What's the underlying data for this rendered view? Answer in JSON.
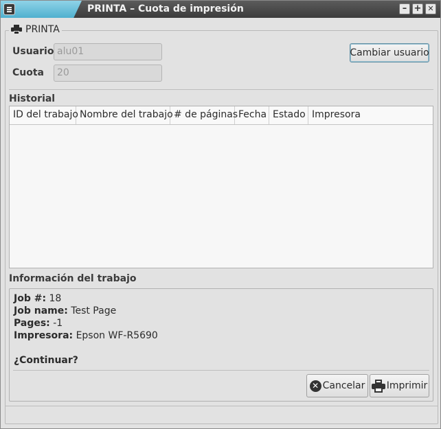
{
  "window": {
    "title": "PRINTA – Cuota de impresión",
    "minimize_icon": "minus-icon",
    "maximize_icon": "plus-icon",
    "close_icon": "x-icon",
    "minimize_glyph": "–",
    "maximize_glyph": "+",
    "close_glyph": "✕",
    "accent_color": "#5fb8d4"
  },
  "group": {
    "title": "PRINTA",
    "icon": "printer-icon"
  },
  "user": {
    "usuario_label": "Usuario",
    "usuario_value": "alu01",
    "cuota_label": "Cuota",
    "cuota_value": "20",
    "change_user_button": "Cambiar usuario"
  },
  "history": {
    "title": "Historial",
    "columns": [
      "ID del trabajo",
      "Nombre del trabajo",
      "# de páginas",
      "Fecha",
      "Estado",
      "Impresora"
    ],
    "rows": []
  },
  "job_info": {
    "title": "Información del trabajo",
    "job_number_label": "Job #:",
    "job_number_value": "18",
    "job_name_label": "Job name:",
    "job_name_value": "Test Page",
    "pages_label": "Pages:",
    "pages_value": "-1",
    "printer_label": "Impresora:",
    "printer_value": "Epson WF-R5690",
    "question": "¿Continuar?",
    "cancel_button": "Cancelar",
    "cancel_icon": "cancel-circle-icon",
    "print_button": "Imprimir",
    "print_icon": "printer-icon"
  }
}
